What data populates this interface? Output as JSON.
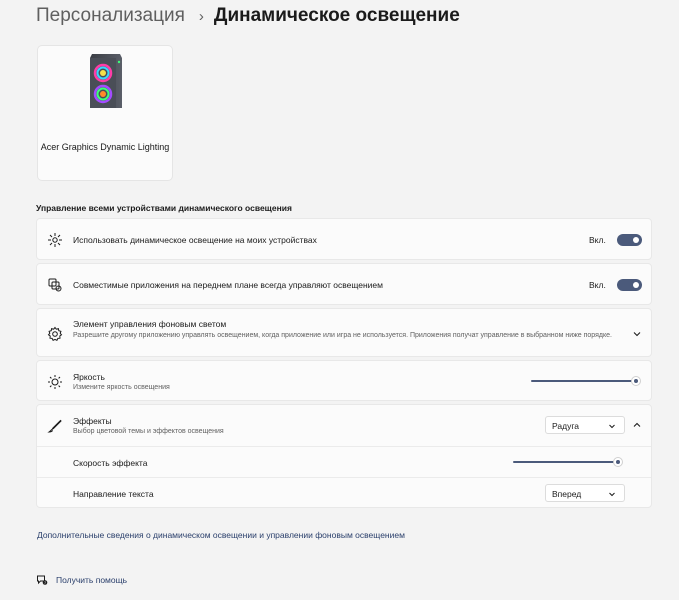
{
  "breadcrumb": {
    "parent": "Персонализация",
    "separator": "›",
    "current": "Динамическое освещение"
  },
  "device": {
    "name": "Acer Graphics Dynamic Lighting",
    "icon": "pc-tower-rgb-icon"
  },
  "section_title": "Управление всеми устройствами динамического освещения",
  "settings": {
    "use_lighting": {
      "icon": "sparkle-icon",
      "title": "Использовать динамическое освещение на моих устройствах",
      "toggle_label": "Вкл.",
      "toggle_on": true
    },
    "foreground_apps": {
      "icon": "apps-icon",
      "title": "Совместимые приложения на переднем плане всегда управляют освещением",
      "toggle_label": "Вкл.",
      "toggle_on": true
    },
    "background_control": {
      "icon": "gear-icon",
      "title": "Элемент управления фоновым светом",
      "subtitle": "Разрешите другому приложению управлять освещением, когда приложение или игра не используется. Приложения получат управление в выбранном ниже порядке.",
      "expanded": false
    },
    "brightness": {
      "icon": "sun-icon",
      "title": "Яркость",
      "subtitle": "Измените яркость освещения",
      "value_percent": 100
    },
    "effects": {
      "icon": "brush-icon",
      "title": "Эффекты",
      "subtitle": "Выбор цветовой темы и эффектов освещения",
      "selected": "Радуга",
      "expanded": true,
      "speed_label": "Скорость эффекта",
      "speed_percent": 100,
      "direction_label": "Направление текста",
      "direction_selected": "Вперед"
    }
  },
  "links": {
    "more_info": "Дополнительные сведения о динамическом освещении и управлении фоновым освещением",
    "help": "Получить помощь"
  },
  "colors": {
    "accent": "#4b5a7b",
    "link": "#2a3f6b",
    "background": "#f3f3f3",
    "card": "#fbfbfb"
  }
}
